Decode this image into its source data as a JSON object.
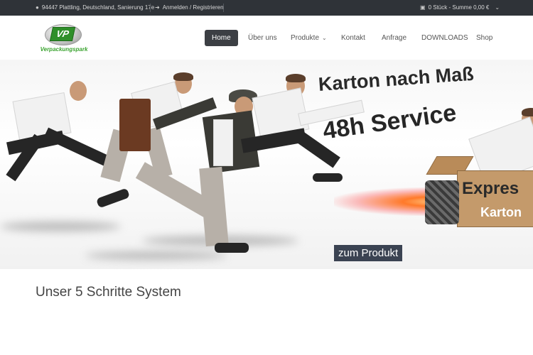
{
  "topbar": {
    "address": "94447 Plattling, Deutschland, Sanierung 17e",
    "login": "Anmelden / Registrieren",
    "cart": "0 Stück - Summe 0,00 €"
  },
  "logo": {
    "mark": "VP",
    "text": "Verpackungspark"
  },
  "nav": {
    "items": [
      "Home",
      "Über uns",
      "Produkte",
      "Kontakt",
      "Anfrage",
      "DOWNLOADS",
      "Shop"
    ],
    "active": "Home"
  },
  "hero": {
    "headline1": "Karton nach Maß",
    "headline2": "48h Service",
    "box_line1": "Expres",
    "box_line2": "Karton",
    "cta": "zum Produkt"
  },
  "section": {
    "title": "Unser 5 Schritte System"
  },
  "colors": {
    "topbar": "#2f3338",
    "nav_active": "#3c3f44",
    "cta": "#3b4352",
    "logo_green": "#3aa32f"
  },
  "icons": [
    "map-marker-icon",
    "sign-in-icon",
    "shopping-bag-icon",
    "chevron-down-icon"
  ]
}
